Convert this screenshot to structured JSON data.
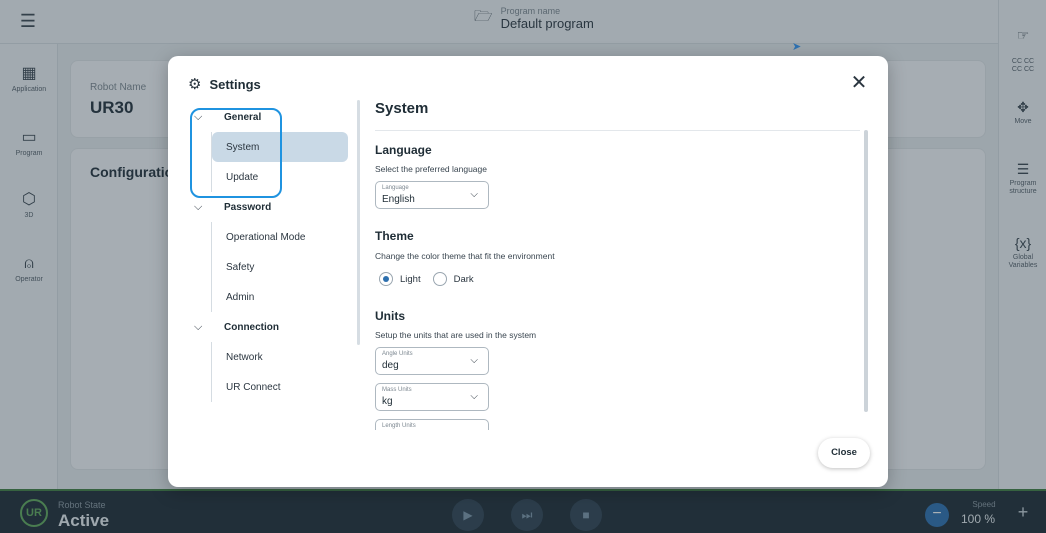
{
  "topbar": {
    "program_label": "Program name",
    "program_name": "Default program"
  },
  "left_rail": {
    "items": [
      {
        "label": "Application",
        "icon": "grid-icon"
      },
      {
        "label": "Program",
        "icon": "program-icon"
      },
      {
        "label": "3D",
        "icon": "cube-icon"
      },
      {
        "label": "Operator",
        "icon": "person-icon"
      }
    ]
  },
  "right_rail": {
    "items": [
      {
        "label": "",
        "icon": "hand-icon"
      },
      {
        "label": "CC CC\nCC CC",
        "icon": "cc-icon"
      },
      {
        "label": "Move",
        "icon": "move-icon"
      },
      {
        "label": "Program structure",
        "icon": "list-icon"
      },
      {
        "label": "Global Variables",
        "icon": "variables-icon"
      }
    ]
  },
  "background": {
    "robot_name_label": "Robot Name",
    "robot_name": "UR30",
    "configuration": "Configuration"
  },
  "bottombar": {
    "robot_state_label": "Robot State",
    "robot_state": "Active",
    "speed_label": "Speed",
    "speed_value": "100 %"
  },
  "settings": {
    "title": "Settings",
    "close_label": "Close",
    "nav": {
      "general": "General",
      "system": "System",
      "update": "Update",
      "password": "Password",
      "operational_mode": "Operational Mode",
      "safety": "Safety",
      "admin": "Admin",
      "connection": "Connection",
      "network": "Network",
      "ur_connect": "UR Connect"
    },
    "content": {
      "heading": "System",
      "language": {
        "title": "Language",
        "desc": "Select the preferred language",
        "field_label": "Language",
        "value": "English"
      },
      "theme": {
        "title": "Theme",
        "desc": "Change the color theme that fit the environment",
        "light": "Light",
        "dark": "Dark",
        "selected": "Light"
      },
      "units": {
        "title": "Units",
        "desc": "Setup the units that are used in the system",
        "angle_label": "Angle Units",
        "angle_value": "deg",
        "mass_label": "Mass Units",
        "mass_value": "kg",
        "length_label": "Length Units"
      }
    }
  },
  "colors": {
    "accent": "#1f93e0",
    "selected_bg": "#c9d9e6",
    "bottom_bar": "#1d2b35",
    "robot_green": "#5fa85a"
  }
}
